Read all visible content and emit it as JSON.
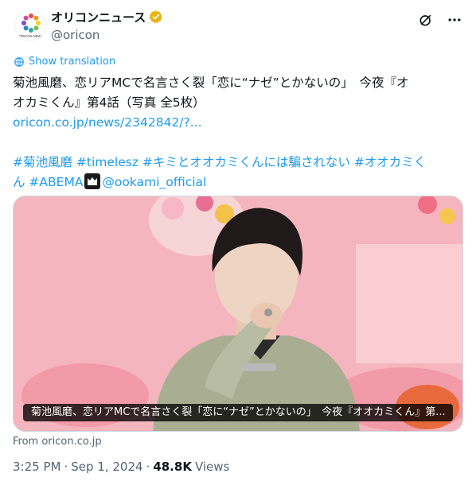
{
  "author": {
    "display_name": "オリコンニュース",
    "handle": "@oricon",
    "avatar_text": "ORICON NEWS",
    "verified_color": "#e8b518"
  },
  "show_translation": "Show translation",
  "tweet": {
    "line1": "菊池風磨、恋リアMCで名言さく裂「恋に“ナゼ”とかないの」　今夜『オ",
    "line2": "オカミくん』第4話（写真 全5枚）",
    "link": "oricon.co.jp/news/2342842/?...",
    "hashtags_line1": " #菊池風磨 #timelesz #キミとオオカミくんには騙されない #オオカミく",
    "hashtags_line2_a": "ん #ABEMA",
    "mention": "@ookami_official"
  },
  "media": {
    "caption": "菊池風磨、恋リアMCで名言さく裂「恋に“ナゼ”とかないの」　今夜『オオカミくん』第..."
  },
  "from_label": "From oricon.co.jp",
  "meta": {
    "time": "3:25 PM",
    "sep": "·",
    "date": "Sep 1, 2024",
    "views_count": "48.8K",
    "views_label": "Views"
  },
  "colors": {
    "link": "#1d9bf0",
    "secondary_text": "#536471",
    "text": "#0f1419"
  }
}
